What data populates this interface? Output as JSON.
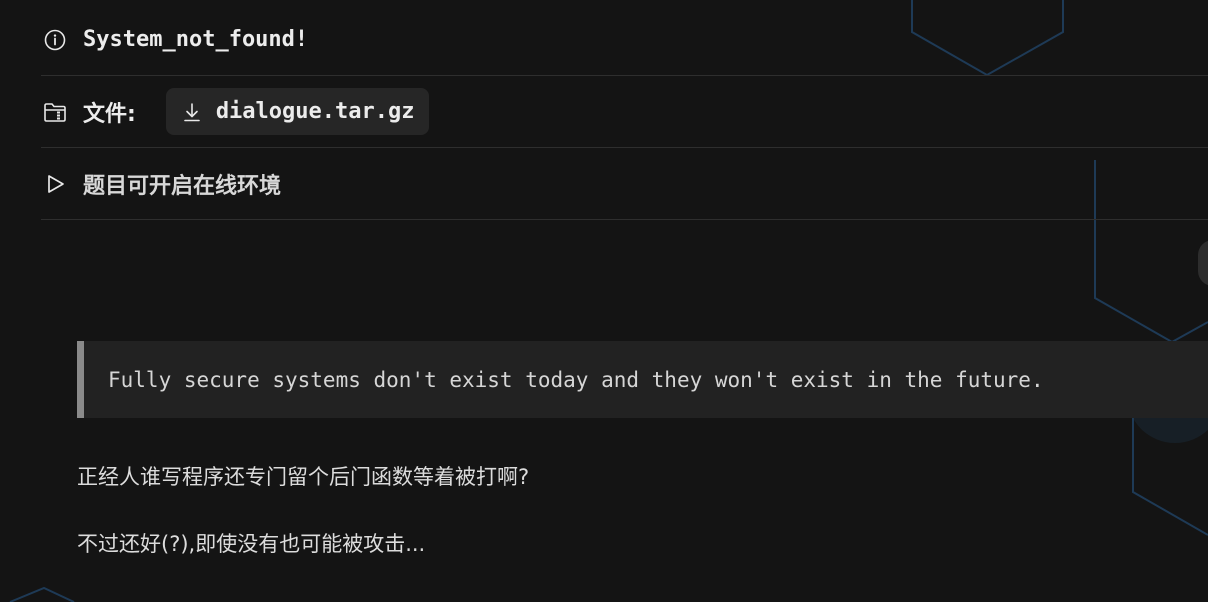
{
  "challenge": {
    "title": "System_not_found!",
    "file_label": "文件:",
    "file_name": "dialogue.tar.gz",
    "environment_label": "题目可开启在线环境"
  },
  "content": {
    "quote": "Fully secure systems don't exist today and they won't exist in the future.",
    "paragraph1": "正经人谁写程序还专门留个后门函数等着被打啊?",
    "paragraph2": "不过还好(?),即使没有也可能被攻击..."
  },
  "icons": {
    "title": "info-icon",
    "file": "folder-zip-icon",
    "download": "download-icon",
    "environment": "play-icon"
  },
  "colors": {
    "background": "#141414",
    "hex_outline": "#1e3a56",
    "chip_bg": "#262626",
    "quote_bg": "#222222",
    "quote_bar": "#8a8a8a"
  }
}
